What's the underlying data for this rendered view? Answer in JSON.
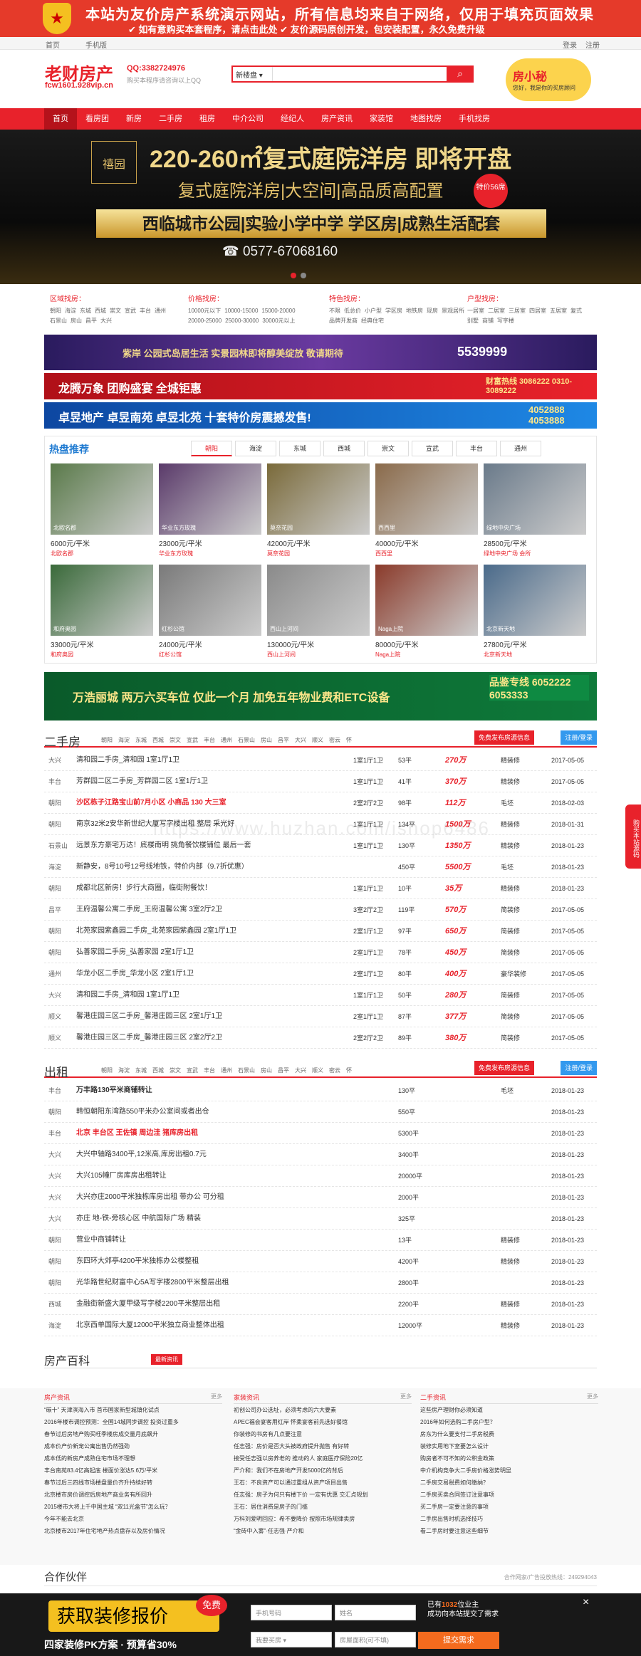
{
  "banner": {
    "line1": "本站为友价房产系统演示网站，所有信息均来自于网络，仅用于填充页面效果",
    "line2": "✔ 如有意购买本套程序，请点击此处     ✔ 友价源码原创开发，包安装配置，永久免费升级"
  },
  "topnav": {
    "home": "首页",
    "mobile": "手机版",
    "login": "登录",
    "register": "注册"
  },
  "header": {
    "logo": "老财房产",
    "domain": "fcw1601.928vip.cn",
    "qq": "QQ:3382724976",
    "qq_sub": "购买本程序请咨询以上QQ",
    "search_type": "新楼盘 ▾",
    "search_icon": "search-icon",
    "mascot": "房小秘",
    "mascot_sub": "您好，我是你的买房顾问"
  },
  "nav": [
    "首页",
    "看房团",
    "新房",
    "二手房",
    "租房",
    "中介公司",
    "经纪人",
    "房产资讯",
    "家装馆",
    "地图找房",
    "手机找房"
  ],
  "hero": {
    "logo_text": "禧园",
    "title": "220-260㎡复式庭院洋房 即将开盘",
    "subtitle": "复式庭院洋房|大空间|高品质高配置",
    "badge": "特价56席",
    "slogan": "西临城市公园|实验小学中学 学区房|成熟生活配套",
    "tel": "☎ 0577-67068160"
  },
  "filters": [
    {
      "title": "区域找房：",
      "items": [
        "朝阳",
        "海淀",
        "东城",
        "西城",
        "崇文",
        "宣武",
        "丰台",
        "通州",
        "石景山",
        "房山",
        "昌平",
        "大兴"
      ]
    },
    {
      "title": "价格找房：",
      "items": [
        "10000元以下",
        "10000-15000",
        "15000-20000",
        "20000-25000",
        "25000-30000",
        "30000元以上"
      ]
    },
    {
      "title": "特色找房：",
      "items": [
        "不限",
        "低总价",
        "小户型",
        "学区房",
        "地铁房",
        "现房",
        "景观居所",
        "品牌开发商",
        "经典住宅"
      ]
    },
    {
      "title": "户型找房：",
      "items": [
        "一居室",
        "二居室",
        "三居室",
        "四居室",
        "五居室",
        "复式",
        "别墅",
        "商铺",
        "写字楼"
      ]
    }
  ],
  "ads": [
    {
      "text": "紫岸 公园式岛居生活 实景园林即将醇美绽放 敬请期待",
      "tel": "5539999"
    },
    {
      "text": "龙腾万象     团购盛宴  全城钜惠",
      "tel": "财富热线 3086222 0310-3089222"
    },
    {
      "text": "卓昱地产  卓昱南苑  卓昱北苑    十套特价房震撼发售!",
      "tel": "4052888 4053888"
    },
    {
      "text": "万浩丽城    两万六买车位 仅此一个月 加免五年物业费和ETC设备",
      "tel": "品鉴专线 6052222 6053333"
    }
  ],
  "hot": {
    "title": "热盘推荐",
    "tabs": [
      "朝阳",
      "海淀",
      "东城",
      "西城",
      "崇文",
      "宣武",
      "丰台",
      "通州"
    ],
    "cards": [
      {
        "label": "北欧名郡",
        "price": "6000元/平米",
        "name": "北欧名郡",
        "color": "#5a7a4a"
      },
      {
        "label": "华业东方玫瑰",
        "price": "23000元/平米",
        "name": "华业东方玫瑰",
        "color": "#5a3a6a"
      },
      {
        "label": "莫奈花园",
        "price": "42000元/平米",
        "name": "莫奈花园",
        "color": "#7a6a3a"
      },
      {
        "label": "西西里",
        "price": "40000元/平米",
        "name": "西西里",
        "color": "#8a6a4a"
      },
      {
        "label": "绿地中央广场",
        "price": "28500元/平米",
        "name": "绿地中央广场 会所",
        "color": "#6a7a8a"
      },
      {
        "label": "和府奥园",
        "price": "33000元/平米",
        "name": "和府奥园",
        "color": "#3a6a3a"
      },
      {
        "label": "红杉公馆",
        "price": "24000元/平米",
        "name": "红杉公馆",
        "color": "#7a7a7a"
      },
      {
        "label": "西山上河间",
        "price": "130000元/平米",
        "name": "西山上河间",
        "color": "#8a8a8a"
      },
      {
        "label": "Naga上院",
        "price": "80000元/平米",
        "name": "Naga上院",
        "color": "#8a3a2a"
      },
      {
        "label": "北京新天地",
        "price": "27800元/平米",
        "name": "北京新天地",
        "color": "#4a6a8a"
      }
    ]
  },
  "ershou": {
    "title": "二手房",
    "areas": [
      "朝阳",
      "海淀",
      "东城",
      "西城",
      "崇文",
      "宣武",
      "丰台",
      "通州",
      "石景山",
      "房山",
      "昌平",
      "大兴",
      "顺义",
      "密云",
      "怀"
    ],
    "btn1": "免费发布房源信息",
    "btn2": "注册/登录",
    "rows": [
      {
        "a": "大兴",
        "t": "清和园二手房_清和园 1室1厅1卫",
        "s": "",
        "r": "1室1厅1卫",
        "ar": "53平",
        "p": "270万",
        "d": "精装修",
        "dt": "2017-05-05"
      },
      {
        "a": "丰台",
        "t": "芳群园二区二手房_芳群园二区 1室1厅1卫",
        "s": "",
        "r": "1室1厅1卫",
        "ar": "41平",
        "p": "370万",
        "d": "精装修",
        "dt": "2017-05-05"
      },
      {
        "a": "朝阳",
        "t": "沙区栋子江路宝山前7月小区 小商品 130 大三室",
        "s": "red",
        "r": "2室2厅2卫",
        "ar": "98平",
        "p": "112万",
        "d": "毛坯",
        "dt": "2018-02-03"
      },
      {
        "a": "朝阳",
        "t": "南京32米2安华新世纪大厦写字楼出租 整层 采光好",
        "s": "",
        "r": "1室1厅1卫",
        "ar": "134平",
        "p": "1500万",
        "d": "精装修",
        "dt": "2018-01-31"
      },
      {
        "a": "石景山",
        "t": "远景东方豪宅万达！底楼南明 挑角餐饮楼铺位 最后一套",
        "s": "",
        "r": "1室1厅1卫",
        "ar": "130平",
        "p": "1350万",
        "d": "精装修",
        "dt": "2018-01-23"
      },
      {
        "a": "海淀",
        "t": "新静安，8号10号12号线地铁，特价内部（9.7折优惠）",
        "s": "",
        "r": "",
        "ar": "450平",
        "p": "5500万",
        "d": "毛坯",
        "dt": "2018-01-23"
      },
      {
        "a": "朝阳",
        "t": "成都北区新房！步行大商圈，临街附餐饮！",
        "s": "",
        "r": "1室1厅1卫",
        "ar": "10平",
        "p": "35万",
        "d": "精装修",
        "dt": "2018-01-23"
      },
      {
        "a": "昌平",
        "t": "王府温馨公寓二手房_王府温馨公寓 3室2厅2卫",
        "s": "",
        "r": "3室2厅2卫",
        "ar": "119平",
        "p": "570万",
        "d": "简装修",
        "dt": "2017-05-05"
      },
      {
        "a": "朝阳",
        "t": "北苑家园紫鑫园二手房_北苑家园紫鑫园 2室1厅1卫",
        "s": "",
        "r": "2室1厅1卫",
        "ar": "97平",
        "p": "650万",
        "d": "简装修",
        "dt": "2017-05-05"
      },
      {
        "a": "朝阳",
        "t": "弘善家园二手房_弘善家园 2室1厅1卫",
        "s": "",
        "r": "2室1厅1卫",
        "ar": "78平",
        "p": "450万",
        "d": "简装修",
        "dt": "2017-05-05"
      },
      {
        "a": "通州",
        "t": "华龙小区二手房_华龙小区 2室1厅1卫",
        "s": "",
        "r": "2室1厅1卫",
        "ar": "80平",
        "p": "400万",
        "d": "豪华装修",
        "dt": "2017-05-05"
      },
      {
        "a": "大兴",
        "t": "清和园二手房_清和园 1室1厅1卫",
        "s": "",
        "r": "1室1厅1卫",
        "ar": "50平",
        "p": "280万",
        "d": "简装修",
        "dt": "2017-05-05"
      },
      {
        "a": "顺义",
        "t": "馨港庄园三区二手房_馨港庄园三区 2室1厅1卫",
        "s": "",
        "r": "2室1厅1卫",
        "ar": "87平",
        "p": "377万",
        "d": "简装修",
        "dt": "2017-05-05"
      },
      {
        "a": "顺义",
        "t": "馨港庄园三区二手房_馨港庄园三区 2室2厅2卫",
        "s": "",
        "r": "2室2厅2卫",
        "ar": "89平",
        "p": "380万",
        "d": "简装修",
        "dt": "2017-05-05"
      }
    ]
  },
  "chuzu": {
    "title": "出租",
    "areas": [
      "朝阳",
      "海淀",
      "东城",
      "西城",
      "崇文",
      "宣武",
      "丰台",
      "通州",
      "石景山",
      "房山",
      "昌平",
      "大兴",
      "顺义",
      "密云",
      "怀"
    ],
    "btn1": "免费发布房源信息",
    "btn2": "注册/登录",
    "rows": [
      {
        "a": "丰台",
        "t": "万丰路130平米商铺转让",
        "s": "bold",
        "ar": "130平",
        "d": "毛坯",
        "dt": "2018-01-23"
      },
      {
        "a": "朝阳",
        "t": "韩恒朝阳东湾路550平米办公室间或者出仓",
        "s": "",
        "ar": "550平",
        "d": "",
        "dt": "2018-01-23"
      },
      {
        "a": "丰台",
        "t": "北京 丰台区 王佐镇 周边洼 猪库房出租",
        "s": "red",
        "ar": "5300平",
        "d": "",
        "dt": "2018-01-23"
      },
      {
        "a": "大兴",
        "t": "大兴中轴路3400平,12米高,库房出租0.7元",
        "s": "",
        "ar": "3400平",
        "d": "",
        "dt": "2018-01-23"
      },
      {
        "a": "大兴",
        "t": "大兴105幢厂房库房出租转让",
        "s": "",
        "ar": "20000平",
        "d": "",
        "dt": "2018-01-23"
      },
      {
        "a": "大兴",
        "t": "大兴亦庄2000平米独栋库房出租 带办公 可分租",
        "s": "",
        "ar": "2000平",
        "d": "",
        "dt": "2018-01-23"
      },
      {
        "a": "大兴",
        "t": "亦庄 地-铁-旁核心区 中航国际广场 精装",
        "s": "",
        "ar": "325平",
        "d": "",
        "dt": "2018-01-23"
      },
      {
        "a": "朝阳",
        "t": "营业中商铺转让",
        "s": "",
        "ar": "13平",
        "d": "精装修",
        "dt": "2018-01-23"
      },
      {
        "a": "朝阳",
        "t": "东四环大郊亭4200平米独栋办公楼整租",
        "s": "",
        "ar": "4200平",
        "d": "精装修",
        "dt": "2018-01-23"
      },
      {
        "a": "朝阳",
        "t": "光华路世纪财富中心5A写字楼2800平米整层出租",
        "s": "",
        "ar": "2800平",
        "d": "",
        "dt": "2018-01-23"
      },
      {
        "a": "西城",
        "t": "金融街新盛大厦甲级写字楼2200平米整层出租",
        "s": "",
        "ar": "2200平",
        "d": "精装修",
        "dt": "2018-01-23"
      },
      {
        "a": "海淀",
        "t": "北京西单国际大厦12000平米独立商业整体出租",
        "s": "",
        "ar": "12000平",
        "d": "精装修",
        "dt": "2018-01-23"
      }
    ]
  },
  "wiki": {
    "title": "房产百科",
    "tag": "最新资讯",
    "cols": [
      {
        "title": "房产资讯",
        "more": "更多",
        "items": [
          "“碳十”  天津滨海入市 首市国家新型城镇化试点",
          "2016年楼市调控预测：全国14城同步调控 投资过重多",
          "春节过后房地产购买旺季楼房成交量月底飙升",
          "成本价产价新宠公寓出售仍然强劲",
          "成本低的新房产成熟住宅市场不理想",
          "丰台南苑83.4亿高起底 楼面价涨达5.6万/平米",
          "春节过后三四线市场楼盘量价齐升持续好转",
          "北京楼市房价调控后房地产商业务有所回升",
          "2015楼市大将上千中国主城 “双11光盒节”怎么玩？",
          "今年不能去北京",
          "北京楼市2017年住宅地产热点盘存以及房价情况"
        ]
      },
      {
        "title": "家装资讯",
        "more": "更多",
        "items": [
          "初创公司办公选址，必须考虑的六大要素",
          "APEC福会宴客用红岸 怀柔宴客前先选好餐馆",
          "你装修的书房有几点要注意",
          "任志强：房价是否大头被政府提升抛售 有好转",
          "接受任志强以房养老的 推动的人 家庭医疗保险20亿",
          "严介和：我们不在房地产开发5000亿的背后",
          "王石：不良资产可以通过重组从资产项目出售",
          "任志强：房子为何只有楼下价 一定有优惠 交汇点规划",
          "王石：居住消费是房子的门槛",
          "万科刘爱明回应：希不要降价 按照市场规律卖房",
          "“金砖中入雾”·任志强·严介和"
        ]
      },
      {
        "title": "二手资讯",
        "more": "更多",
        "items": [
          "这些房产理财你必须知道",
          "2016年如何选购二手房户型？",
          "房东为什么要支付二手房税费",
          "装修实用地下室要怎么设计",
          "购房者不可不知的公积金政策",
          "中介机构竞争大二手房价格涨势明显",
          "二手房交易税费如何缴纳？",
          "二手房买卖合同签订注意事项",
          "买二手房一定要注意的事项",
          "二手房出售时机选择技巧",
          "看二手房时要注意这些细节"
        ]
      }
    ]
  },
  "partners": {
    "title": "合作伙伴",
    "note": "合作网家/广告投放热线：249294043"
  },
  "bottom": {
    "title": "获取装修报价",
    "free": "免费",
    "sub": "四家装修PK方案 · 预算省30%",
    "ph_phone": "手机号码",
    "ph_name": "姓名",
    "ph_select": "我要买房 ▾",
    "ph_area": "房屋面积(可不填)",
    "submit": "提交需求",
    "msg1": "已有",
    "msg_num": "1032",
    "msg2": "位业主",
    "msg3": "成功向本站提交了需求",
    "close": "×"
  },
  "float_btn": "购买本站源码",
  "watermark": "https://www.huzhan.com/ishop6486"
}
